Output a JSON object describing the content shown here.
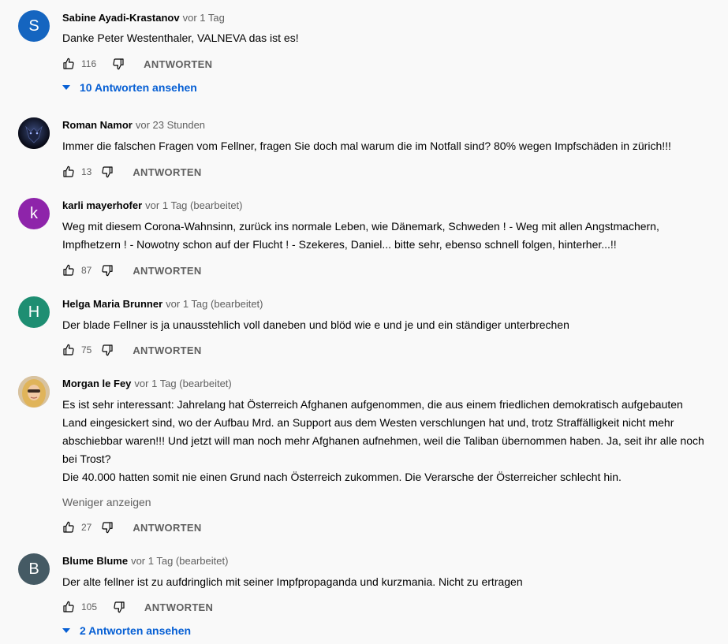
{
  "reply_label": "ANTWORTEN",
  "comments": [
    {
      "author": "Sabine Ayadi-Krastanov",
      "time": "vor 1 Tag",
      "avatar_letter": "S",
      "avatar_color": "#1565c0",
      "text": "Danke Peter Westenthaler, VALNEVA das ist es!",
      "likes": "116",
      "replies_label": "10 Antworten ansehen"
    },
    {
      "author": "Roman Namor",
      "time": "vor 23 Stunden",
      "avatar_letter": "",
      "avatar_color": "#1b1f3a",
      "text": "Immer die falschen Fragen vom Fellner, fragen Sie doch mal warum die im Notfall sind? 80% wegen Impfschäden in zürich!!!",
      "likes": "13"
    },
    {
      "author": "karli mayerhofer",
      "time": "vor 1 Tag (bearbeitet)",
      "avatar_letter": "k",
      "avatar_color": "#8e24aa",
      "text": "Weg mit diesem Corona-Wahnsinn, zurück ins normale Leben, wie Dänemark, Schweden ! - Weg mit allen Angstmachern, Impfhetzern ! - Nowotny schon auf der Flucht ! - Szekeres, Daniel... bitte sehr, ebenso schnell folgen, hinterher...!!",
      "likes": "87"
    },
    {
      "author": "Helga Maria Brunner",
      "time": "vor 1 Tag (bearbeitet)",
      "avatar_letter": "H",
      "avatar_color": "#1e8e72",
      "text": "Der blade Fellner is ja unausstehlich voll daneben und blöd wie e und je und ein ständiger unterbrechen",
      "likes": "75"
    },
    {
      "author": "Morgan le Fey",
      "time": "vor 1 Tag (bearbeitet)",
      "avatar_letter": "",
      "avatar_color": "#c9a574",
      "text": "Es ist sehr interessant: Jahrelang hat Österreich Afghanen aufgenommen, die aus einem friedlichen demokratisch aufgebauten Land eingesickert sind, wo der Aufbau Mrd. an Support aus dem Westen verschlungen hat  und, trotz Straffälligkeit nicht mehr abschiebbar waren!!! Und jetzt will man noch mehr Afghanen aufnehmen, weil die Taliban übernommen haben. Ja, seit ihr alle noch bei Trost?\nDie 40.000 hatten somit nie einen Grund nach Österreich zukommen. Die Verarsche der Österreicher schlecht hin.",
      "show_less_label": "Weniger anzeigen",
      "likes": "27"
    },
    {
      "author": "Blume Blume",
      "time": "vor 1 Tag (bearbeitet)",
      "avatar_letter": "B",
      "avatar_color": "#455a64",
      "text": "Der alte fellner ist zu aufdringlich mit seiner Impfpropaganda und kurzmania. Nicht zu ertragen",
      "likes": "105",
      "replies_label": "2 Antworten ansehen"
    }
  ]
}
